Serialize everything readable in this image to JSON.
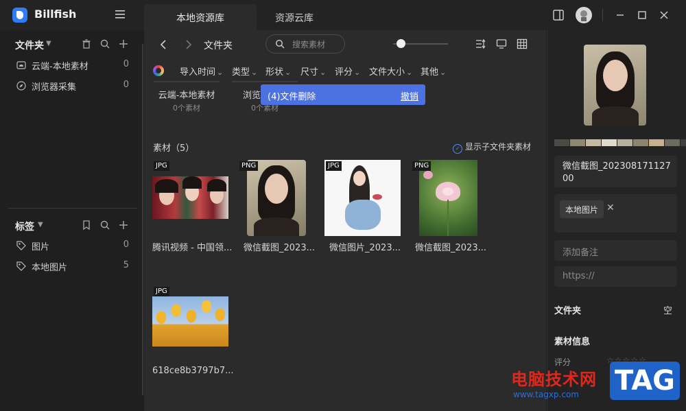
{
  "app": {
    "title": "Billfish"
  },
  "tabs": [
    {
      "label": "本地资源库"
    },
    {
      "label": "资源云库"
    }
  ],
  "sidebar": {
    "folders_title": "文件夹",
    "folders": [
      {
        "label": "云端-本地素材",
        "count": "0"
      },
      {
        "label": "浏览器采集",
        "count": "0"
      }
    ],
    "tags_title": "标签",
    "tags": [
      {
        "label": "图片",
        "count": "0"
      },
      {
        "label": "本地图片",
        "count": "5"
      }
    ]
  },
  "toolbar": {
    "breadcrumb": "文件夹",
    "search_placeholder": "搜索素材",
    "filters": [
      "导入时间",
      "类型",
      "形状",
      "尺寸",
      "评分",
      "文件大小",
      "其他"
    ]
  },
  "folder_cards": [
    {
      "name": "云端-本地素材",
      "count": "0个素材"
    },
    {
      "name": "浏览",
      "count": "0个素材"
    }
  ],
  "toast": {
    "message": "(4)文件删除",
    "action": "撤销"
  },
  "assets": {
    "title": "素材（5）",
    "show_subfolder": "显示子文件夹素材",
    "items": [
      {
        "badge": "JPG",
        "caption": "腾讯视频 - 中国领..."
      },
      {
        "badge": "PNG",
        "caption": "微信截图_2023..."
      },
      {
        "badge": "JPG",
        "caption": "微信图片_2023..."
      },
      {
        "badge": "PNG",
        "caption": "微信截图_2023..."
      },
      {
        "badge": "JPG",
        "caption": "618ce8b3797b7..."
      }
    ]
  },
  "detail": {
    "palette": [
      "#4a4b43",
      "#8c8874",
      "#c4b9a0",
      "#e0dccd",
      "#b7b0a0",
      "#8d8572",
      "#c9b08c",
      "#6d6a5e",
      "#3f403b"
    ],
    "name": "微信截图_20230817112700",
    "tag": "本地图片",
    "note_placeholder": "添加备注",
    "url_placeholder": "https://",
    "folder_label": "文件夹",
    "folder_value": "空",
    "info_label": "素材信息",
    "rating_label": "评分",
    "rating_stars": "☆☆☆☆☆"
  },
  "watermark": {
    "text": "电脑技术网",
    "url": "www.tagxp.com",
    "tag": "TAG"
  }
}
